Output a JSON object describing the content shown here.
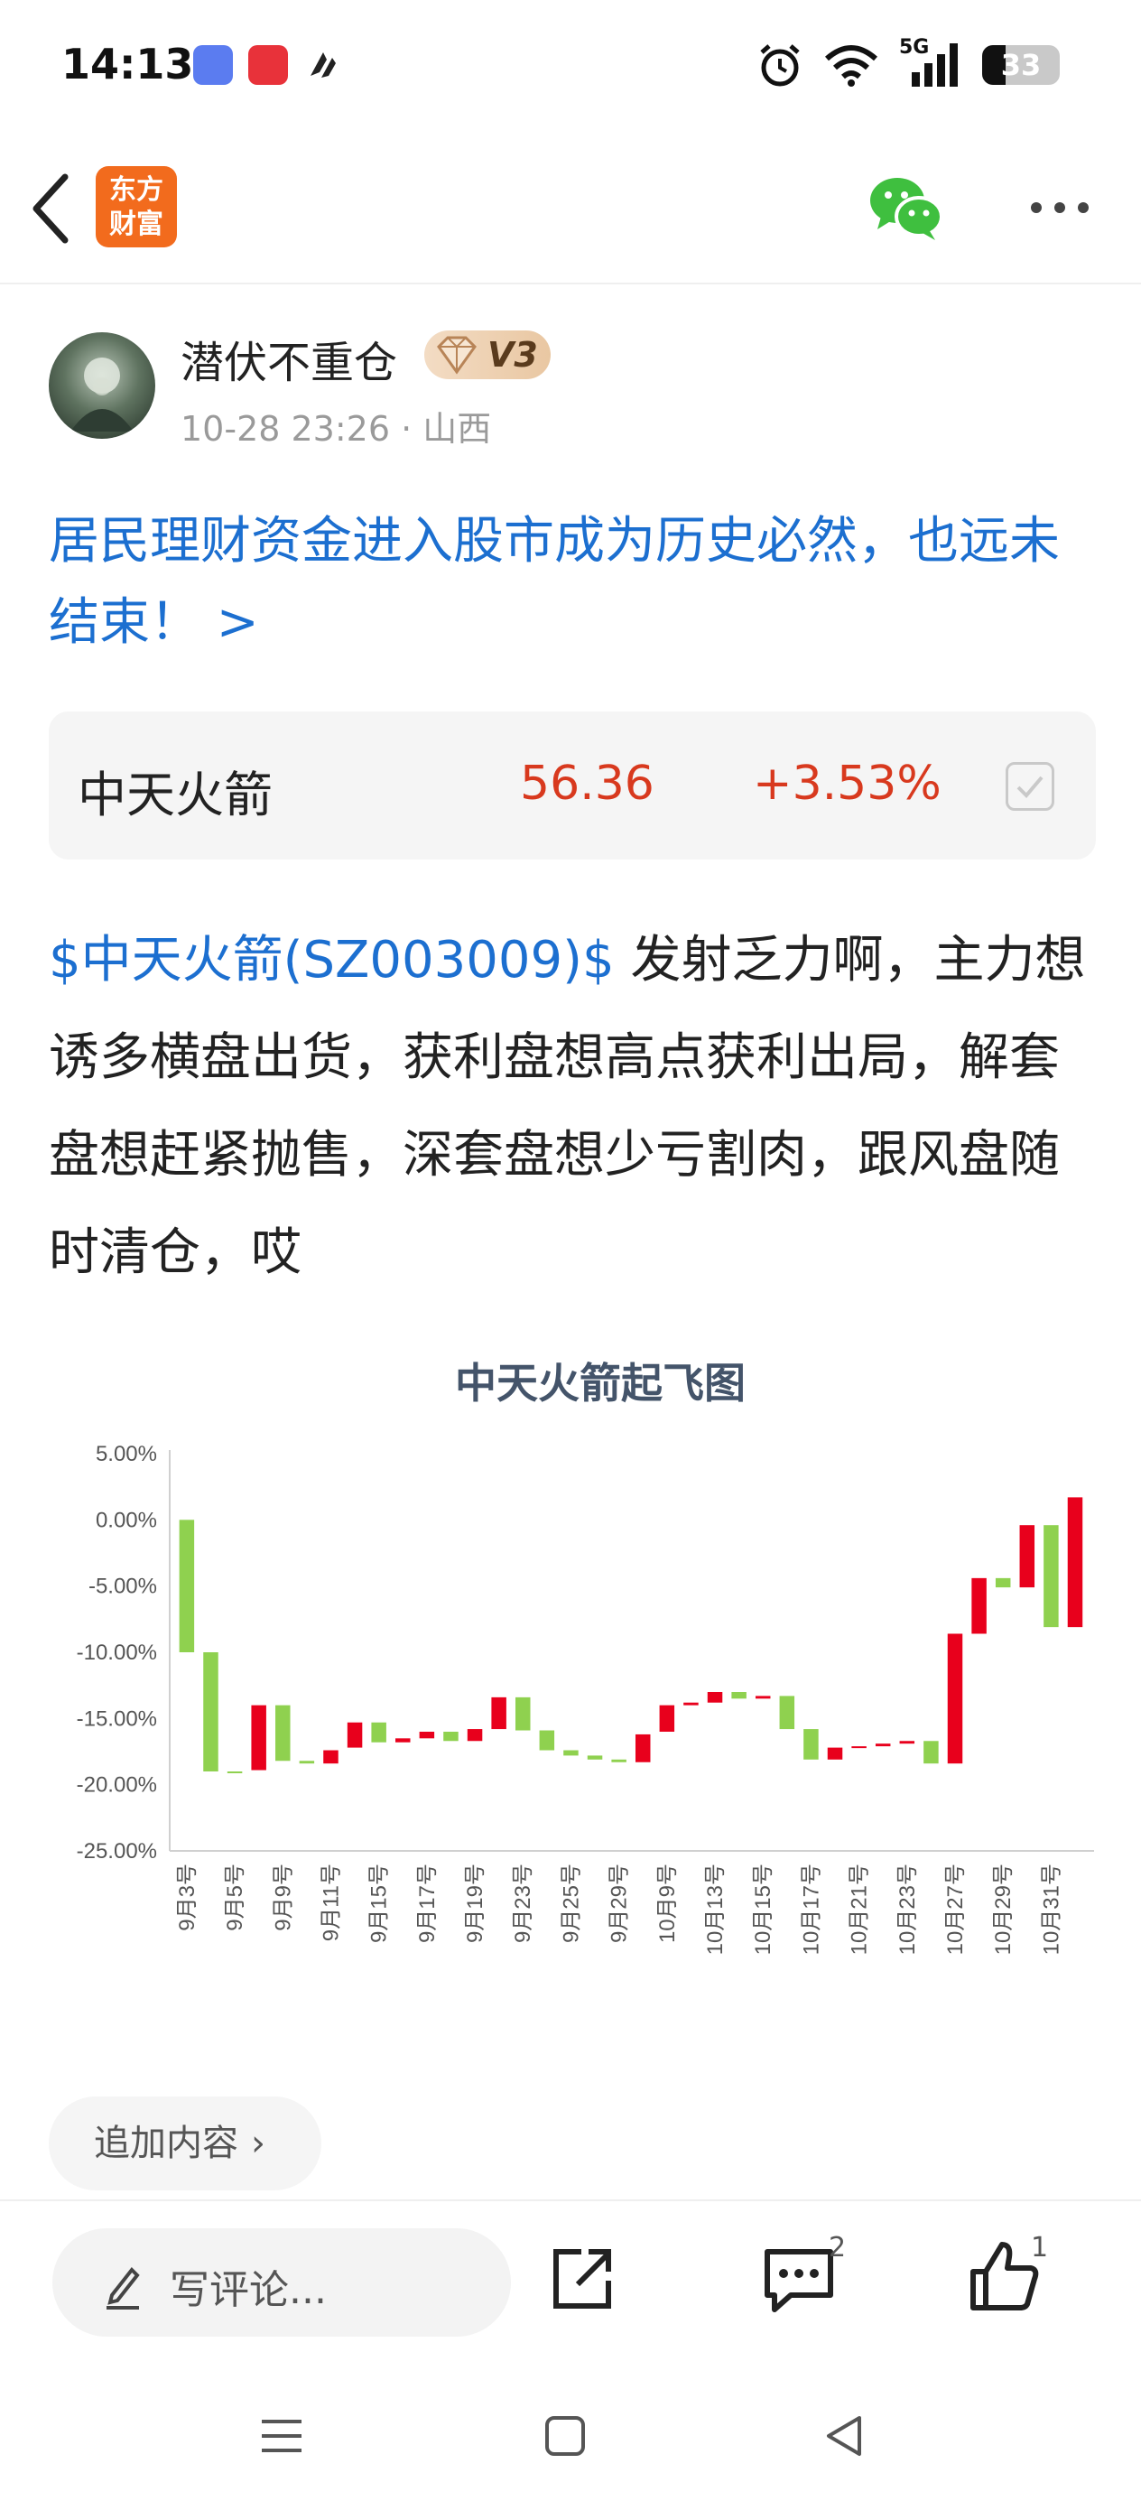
{
  "status_bar": {
    "time": "14:13",
    "network": "5G",
    "battery": "33",
    "icons": [
      "alarm-icon",
      "wifi-icon",
      "signal-icon",
      "battery-icon"
    ]
  },
  "nav": {
    "logo_line1": "东方",
    "logo_line2": "财富",
    "brand_color": "#f26b1d"
  },
  "author": {
    "name": "潜伏不重仓",
    "level": "V3",
    "meta": "10-28 23:26 · 山西"
  },
  "post": {
    "title": "居民理财资金进入股市成为历史必然，也远未结束！ >",
    "stock_link": "$中天火箭(SZ003009)$",
    "body_text": " 发射乏力啊，主力想诱多横盘出货，获利盘想高点获利出局，解套盘想赶紧抛售，深套盘想少亏割肉，跟风盘随时清仓，哎"
  },
  "stock_card": {
    "name": "中天火箭",
    "price": "56.36",
    "change": "+3.53%",
    "up_color": "#d8391e"
  },
  "chart_data": {
    "type": "bar",
    "subtype": "waterfall",
    "title": "中天火箭起飞图",
    "ylim": [
      -25,
      5
    ],
    "y_ticks": [
      "5.00%",
      "0.00%",
      "-5.00%",
      "-10.00%",
      "-15.00%",
      "-20.00%",
      "-25.00%"
    ],
    "x_tick_labels": [
      "9月3号",
      "9月5号",
      "9月9号",
      "9月11号",
      "9月15号",
      "9月17号",
      "9月19号",
      "9月23号",
      "9月25号",
      "9月29号",
      "10月9号",
      "10月13号",
      "10月15号",
      "10月17号",
      "10月21号",
      "10月23号",
      "10月27号",
      "10月29号",
      "10月31号"
    ],
    "colors": {
      "up": "#e8001c",
      "down": "#8fd14f"
    },
    "bars": [
      {
        "start": 0,
        "end": -10
      },
      {
        "start": -10,
        "end": -19
      },
      {
        "start": -19,
        "end": -19.1
      },
      {
        "start": -18.9,
        "end": -14
      },
      {
        "start": -14,
        "end": -18.2
      },
      {
        "start": -18.2,
        "end": -18.4
      },
      {
        "start": -18.4,
        "end": -17.4
      },
      {
        "start": -17.2,
        "end": -15.3
      },
      {
        "start": -15.3,
        "end": -16.8
      },
      {
        "start": -16.8,
        "end": -16.5
      },
      {
        "start": -16.5,
        "end": -16
      },
      {
        "start": -16,
        "end": -16.7
      },
      {
        "start": -16.7,
        "end": -15.8
      },
      {
        "start": -15.8,
        "end": -13.4
      },
      {
        "start": -13.4,
        "end": -15.9
      },
      {
        "start": -15.9,
        "end": -17.4
      },
      {
        "start": -17.4,
        "end": -17.8
      },
      {
        "start": -17.8,
        "end": -18.1
      },
      {
        "start": -18.1,
        "end": -18.3
      },
      {
        "start": -18.3,
        "end": -16.2
      },
      {
        "start": -16,
        "end": -14
      },
      {
        "start": -14,
        "end": -13.8
      },
      {
        "start": -13.8,
        "end": -13
      },
      {
        "start": -13,
        "end": -13.5
      },
      {
        "start": -13.5,
        "end": -13.3
      },
      {
        "start": -13.3,
        "end": -15.8
      },
      {
        "start": -15.8,
        "end": -18.1
      },
      {
        "start": -18.1,
        "end": -17.2
      },
      {
        "start": -17.2,
        "end": -17.1
      },
      {
        "start": -17.1,
        "end": -16.9
      },
      {
        "start": -16.9,
        "end": -16.7
      },
      {
        "start": -16.7,
        "end": -18.4
      },
      {
        "start": -18.4,
        "end": -8.6
      },
      {
        "start": -8.6,
        "end": -4.4
      },
      {
        "start": -4.4,
        "end": -5.1
      },
      {
        "start": -5.1,
        "end": -0.4
      },
      {
        "start": -0.4,
        "end": -8.1
      },
      {
        "start": -8.1,
        "end": 1.7
      }
    ]
  },
  "append": {
    "label": "追加内容"
  },
  "bottom_bar": {
    "comment_placeholder": "写评论...",
    "comment_count": "2",
    "like_count": "1"
  }
}
